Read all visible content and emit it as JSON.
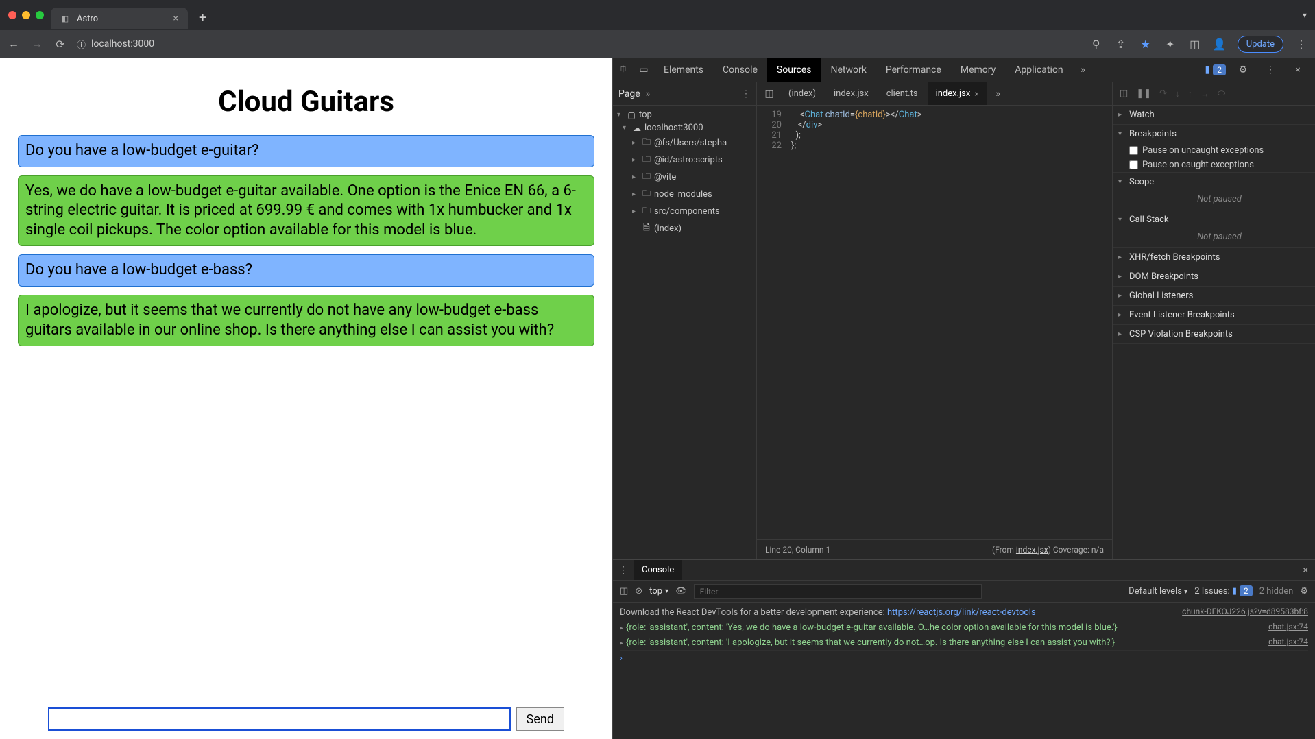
{
  "browser": {
    "tab_title": "Astro",
    "url": "localhost:3000",
    "update_label": "Update"
  },
  "page": {
    "heading": "Cloud Guitars",
    "messages": [
      {
        "role": "user",
        "text": "Do you have a low-budget e-guitar?"
      },
      {
        "role": "bot",
        "text": "Yes, we do have a low-budget e-guitar available. One option is the Enice EN 66, a 6-string electric guitar. It is priced at 699.99 € and comes with 1x humbucker and 1x single coil pickups. The color option available for this model is blue."
      },
      {
        "role": "user",
        "text": "Do you have a low-budget e-bass?"
      },
      {
        "role": "bot",
        "text": "I apologize, but it seems that we currently do not have any low-budget e-bass guitars available in our online shop. Is there anything else I can assist you with?"
      }
    ],
    "send_label": "Send"
  },
  "devtools": {
    "tabs": [
      "Elements",
      "Console",
      "Sources",
      "Network",
      "Performance",
      "Memory",
      "Application"
    ],
    "active_tab": "Sources",
    "issues_count": "2",
    "sources": {
      "nav_tab": "Page",
      "tree": {
        "top": "top",
        "host": "localhost:3000",
        "folders": [
          "@fs/Users/stepha",
          "@id/astro:scripts",
          "@vite",
          "node_modules",
          "src/components"
        ],
        "file": "(index)"
      },
      "open_tabs": [
        {
          "name": "(index)",
          "active": false
        },
        {
          "name": "index.jsx",
          "active": false
        },
        {
          "name": "client.ts",
          "active": false
        },
        {
          "name": "index.jsx",
          "active": true
        }
      ],
      "code_lines": [
        {
          "n": "19",
          "html": "    <span class='tok-punc'>&lt;</span><span class='tok-tag'>Chat</span> <span class='tok-attr'>chatId</span>=<span class='tok-br'>{chatId}</span><span class='tok-punc'>&gt;&lt;/</span><span class='tok-tag'>Chat</span><span class='tok-punc'>&gt;</span>"
        },
        {
          "n": "20",
          "html": "   <span class='tok-punc'>&lt;/</span><span class='tok-tag'>div</span><span class='tok-punc'>&gt;</span>"
        },
        {
          "n": "21",
          "html": "  );"
        },
        {
          "n": "22",
          "html": "};"
        }
      ],
      "status_left": "Line 20, Column 1",
      "status_from": "(From ",
      "status_file": "index.jsx",
      "status_cov": ") Coverage: n/a"
    },
    "debugger": {
      "sections": {
        "watch": "Watch",
        "breakpoints": "Breakpoints",
        "pause_uncaught": "Pause on uncaught exceptions",
        "pause_caught": "Pause on caught exceptions",
        "scope": "Scope",
        "scope_body": "Not paused",
        "callstack": "Call Stack",
        "callstack_body": "Not paused",
        "xhr": "XHR/fetch Breakpoints",
        "dom": "DOM Breakpoints",
        "listeners": "Global Listeners",
        "evtbp": "Event Listener Breakpoints",
        "csp": "CSP Violation Breakpoints"
      }
    },
    "console": {
      "title": "Console",
      "context": "top",
      "filter_placeholder": "Filter",
      "levels": "Default levels",
      "issues_label": "2 Issues:",
      "issues_badge": "2",
      "hidden": "2 hidden",
      "lines": [
        {
          "src": "chunk-DFKOJ226.js?v=d89583bf:8",
          "body_pre": "Download the React DevTools for a better development experience: ",
          "link": "https://reactjs.org/link/react-devtools",
          "cls": "txt"
        },
        {
          "src": "chat.jsx:74",
          "body": "{role: 'assistant', content: 'Yes, we do have a low-budget e-guitar available. O…he color option available for this model is blue.'}",
          "cls": "obj",
          "expand": true
        },
        {
          "src": "chat.jsx:74",
          "body": "{role: 'assistant', content: 'I apologize, but it seems that we currently do not…op. Is there anything else I can assist you with?'}",
          "cls": "obj",
          "expand": true
        }
      ]
    }
  }
}
